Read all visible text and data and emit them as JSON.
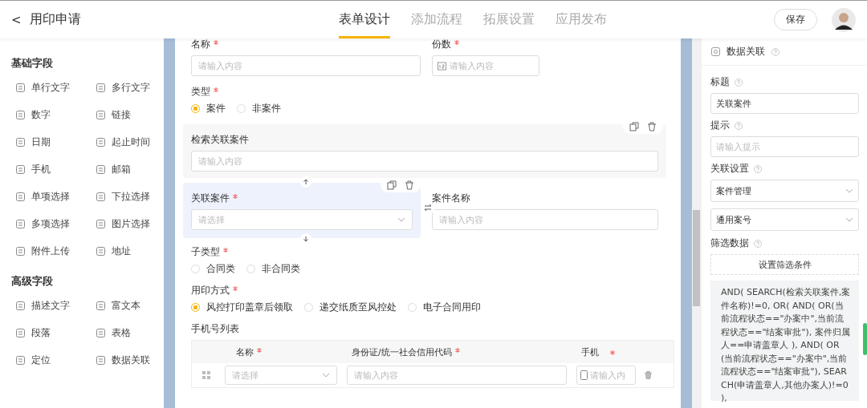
{
  "header": {
    "back": "<",
    "title": "用印申请",
    "tabs": [
      {
        "label": "表单设计",
        "selected": true
      },
      {
        "label": "添加流程",
        "selected": false
      },
      {
        "label": "拓展设置",
        "selected": false
      },
      {
        "label": "应用发布",
        "selected": false
      }
    ],
    "save": "保存"
  },
  "sidebar": {
    "groups": [
      {
        "title": "基础字段",
        "items": [
          "单行文字",
          "多行文字",
          "数字",
          "链接",
          "日期",
          "起止时间",
          "手机",
          "邮箱",
          "单项选择",
          "下拉选择",
          "多项选择",
          "图片选择",
          "附件上传",
          "地址"
        ]
      },
      {
        "title": "高级字段",
        "items": [
          "描述文字",
          "富文本",
          "段落",
          "表格",
          "定位",
          "数据关联"
        ]
      }
    ]
  },
  "form": {
    "name_field": {
      "label": "名称",
      "required": true,
      "placeholder": "请输入内容"
    },
    "copies_field": {
      "label": "份数",
      "required": true,
      "placeholder": "请输入内容"
    },
    "type": {
      "label": "类型",
      "required": true,
      "options": [
        {
          "label": "案件",
          "selected": true
        },
        {
          "label": "非案件",
          "selected": false
        }
      ]
    },
    "search_field": {
      "label": "检索关联案件",
      "placeholder": "请输入内容"
    },
    "linked_case": {
      "label": "关联案件",
      "required": true,
      "placeholder": "请选择"
    },
    "case_name": {
      "label": "案件名称",
      "placeholder": "请输入内容"
    },
    "subtype": {
      "label": "子类型",
      "required": true,
      "options": [
        {
          "label": "合同类",
          "selected": false
        },
        {
          "label": "非合同类",
          "selected": false
        }
      ]
    },
    "seal_method": {
      "label": "用印方式",
      "required": true,
      "options": [
        {
          "label": "风控打印盖章后领取",
          "selected": true
        },
        {
          "label": "递交纸质至风控处",
          "selected": false
        },
        {
          "label": "电子合同用印",
          "selected": false
        }
      ]
    },
    "phone_table": {
      "label": "手机号列表",
      "columns": [
        {
          "label": "名称",
          "required": true
        },
        {
          "label": "身份证/统一社会信用代码",
          "required": true
        },
        {
          "label": "手机",
          "required": true
        }
      ],
      "row": {
        "name_placeholder": "请选择",
        "id_placeholder": "请输入内容",
        "phone_placeholder": "请输入内"
      }
    }
  },
  "panel": {
    "title": "数据关联",
    "title_field": {
      "label": "标题",
      "value": "关联案件"
    },
    "hint_field": {
      "label": "提示",
      "placeholder": "请输入提示"
    },
    "link_settings": {
      "label": "关联设置",
      "selects": [
        "案件管理",
        "通用案号"
      ]
    },
    "filter": {
      "label": "筛选数据",
      "button": "设置筛选条件",
      "formula": "AND( SEARCH(检索关联案件,案件名称)!=0, OR( AND( OR(当前流程状态==\"办案中\",当前流程状态==\"结案审批\"), 案件归属人==申请盖章人 ), AND( OR(当前流程状态==\"办案中\",当前流程状态==\"结案审批\"), SEARCH(申请盖章人,其他办案人)!=0 ),"
    }
  }
}
